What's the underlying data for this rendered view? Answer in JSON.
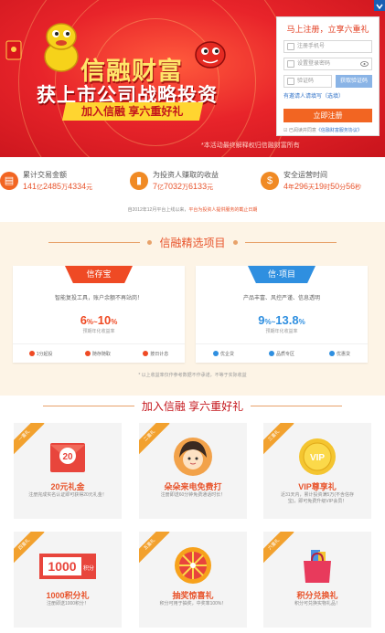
{
  "banner": {
    "brand": "信融财富",
    "slogan": "获上市公司战略投资",
    "ribbon": "加入信融 享六重好礼",
    "note": "*本活动最终解释权归信融财富所有"
  },
  "register": {
    "title": "马上注册，立享六重礼",
    "phone_placeholder": "注册手机号",
    "password_placeholder": "设置登录密码",
    "captcha_placeholder": "验证码",
    "get_code": "获取验证码",
    "invite_link": "有邀请人请填写（选填）",
    "submit": "立即注册",
    "agree_text": "已阅读并同意",
    "agreement_link": "《信融财富服务协议》"
  },
  "stats": [
    {
      "icon": "calculator-icon",
      "label": "累计交易金额",
      "n1": "141",
      "u1": "亿",
      "n2": "2485",
      "u2": "万",
      "n3": "4334",
      "u3": "元",
      "color": "#f26522"
    },
    {
      "icon": "bar-chart-icon",
      "label": "为投资人赚取的收益",
      "n1": "7",
      "u1": "亿",
      "n2": "7032",
      "u2": "万",
      "n3": "6133",
      "u3": "元",
      "color": "#f08a24"
    },
    {
      "icon": "dollar-icon",
      "label": "安全运营时间",
      "n1": "4",
      "u1": "年",
      "n2": "296",
      "u2": "天",
      "n3": "19",
      "u3": "时",
      "n4": "50",
      "u4": "分",
      "n5": "56",
      "u5": "秒",
      "color": "#f08a24"
    }
  ],
  "stats_note": {
    "text": "自2012年12月平台上线以来，",
    "link": "平台为投资人提供服务的截止日期"
  },
  "products": {
    "heading": "信融精选项目",
    "items": [
      {
        "tag": "信存宝",
        "desc": "智能复投工具，账户余额不再站岗！",
        "rate_from": "6",
        "rate_to": "10",
        "rate_label": "预期年化收益率",
        "features": [
          "1分起投",
          "随存随取",
          "按日计息"
        ],
        "color": "#ef4a24"
      },
      {
        "tag": "信·项目",
        "desc": "产品丰富、风控严谨、信息透明",
        "rate_from": "9",
        "rate_to": "13.8",
        "rate_label": "预期年化收益率",
        "features": [
          "优企贷",
          "品质专区",
          "优惠贷"
        ],
        "color": "#2f8fe0"
      }
    ],
    "note": "* 以上收益率仅作参考数据不作承诺，不等于实际收益"
  },
  "rewards": {
    "heading": "加入信融 享六重好礼",
    "items": [
      {
        "ribbon": "一重礼",
        "title": "20元礼金",
        "desc": "注册完成实名认证即可获得20元礼金！",
        "icon": "envelope-icon",
        "amount": "20"
      },
      {
        "ribbon": "二重礼",
        "title": "朵朵来电免费打",
        "desc": "注册即送60分钟免费通话时长！",
        "icon": "avatar-icon"
      },
      {
        "ribbon": "三重礼",
        "title": "VIP尊享礼",
        "desc": "近31天内，累计投资满5万(不含信存宝)，即可免费升级VIP会员！",
        "icon": "vip-badge-icon",
        "badge": "VIP"
      },
      {
        "ribbon": "四重礼",
        "title": "1000积分礼",
        "desc": "注册即送1000积分！",
        "icon": "points-ticket-icon",
        "points": "1000",
        "points_unit": "积分"
      },
      {
        "ribbon": "五重礼",
        "title": "抽奖惊喜礼",
        "desc": "积分可用于抽奖，中奖率100%！",
        "icon": "lucky-wheel-icon"
      },
      {
        "ribbon": "六重礼",
        "title": "积分兑换礼",
        "desc": "积分可兑换实物礼品！",
        "icon": "shopping-bag-icon"
      }
    ]
  },
  "colors": {
    "brand_red": "#e8242a",
    "accent_orange": "#f26522",
    "gold": "#ffe66a",
    "blue": "#2f8fe0",
    "cream": "#fdf4e6"
  }
}
